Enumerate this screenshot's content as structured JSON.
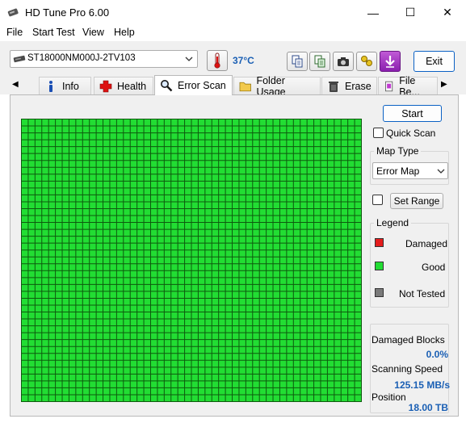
{
  "window": {
    "title": "HD Tune Pro 6.00",
    "minimize_glyph": "—",
    "maximize_glyph": "☐",
    "close_glyph": "✕"
  },
  "menu": {
    "items": [
      "File",
      "Start Test",
      "View",
      "Help"
    ]
  },
  "toolbar": {
    "drive": "ST18000NM000J-2TV103",
    "temperature": "37°C",
    "exit_label": "Exit",
    "icons": [
      "drive-icon",
      "thermometer-icon",
      "copy-text-icon",
      "copy-info-icon",
      "screenshot-camera-icon",
      "options-keys-icon",
      "download-arrow-icon"
    ]
  },
  "tabs": {
    "prev_glyph": "◀",
    "next_glyph": "▶",
    "items": [
      {
        "label": "Info",
        "icon": "info-icon"
      },
      {
        "label": "Health",
        "icon": "health-cross-icon"
      },
      {
        "label": "Error Scan",
        "icon": "magnifier-icon",
        "active": true
      },
      {
        "label": "Folder Usage",
        "icon": "folder-icon"
      },
      {
        "label": "Erase",
        "icon": "trash-icon"
      },
      {
        "label": "File Be...",
        "icon": "file-benchmark-icon"
      }
    ]
  },
  "scan": {
    "start_label": "Start",
    "quick_scan_label": "Quick Scan",
    "quick_scan_checked": false,
    "map_type_title": "Map Type",
    "map_type_value": "Error Map",
    "set_range_label": "Set Range",
    "set_range_checked": false,
    "legend_title": "Legend",
    "legend": [
      {
        "label": "Damaged",
        "color": "#e41c1c"
      },
      {
        "label": "Good",
        "color": "#22dd33"
      },
      {
        "label": "Not Tested",
        "color": "#7a7a7a"
      }
    ],
    "damaged_blocks_label": "Damaged Blocks",
    "damaged_blocks_value": "0.0%",
    "scanning_speed_label": "Scanning Speed",
    "scanning_speed_value": "125.15 MB/s",
    "position_label": "Position",
    "position_value": "18.00 TB"
  },
  "error_map": {
    "cell_color": "#22dd33",
    "grid_line_color": "#0e5a0e",
    "columns": 50,
    "rows": 41
  }
}
